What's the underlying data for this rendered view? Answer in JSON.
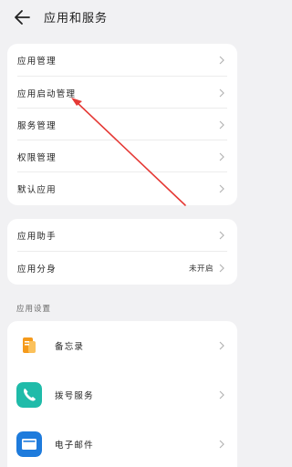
{
  "header": {
    "title": "应用和服务",
    "back_icon": "back-arrow-icon"
  },
  "group1": {
    "items": [
      {
        "label": "应用管理"
      },
      {
        "label": "应用启动管理"
      },
      {
        "label": "服务管理"
      },
      {
        "label": "权限管理"
      },
      {
        "label": "默认应用"
      }
    ]
  },
  "group2": {
    "items": [
      {
        "label": "应用助手",
        "value": ""
      },
      {
        "label": "应用分身",
        "value": "未开启"
      }
    ]
  },
  "section": {
    "title": "应用设置"
  },
  "apps": {
    "items": [
      {
        "label": "备忘录",
        "icon": "memo-app-icon",
        "color": "#f59a1b"
      },
      {
        "label": "拨号服务",
        "icon": "phone-app-icon",
        "color": "#1fbba9"
      },
      {
        "label": "电子邮件",
        "icon": "email-app-icon",
        "color": "#1e7bdc"
      }
    ]
  },
  "colors": {
    "annotation": "#e53935",
    "chevron": "#b5b5b5"
  }
}
